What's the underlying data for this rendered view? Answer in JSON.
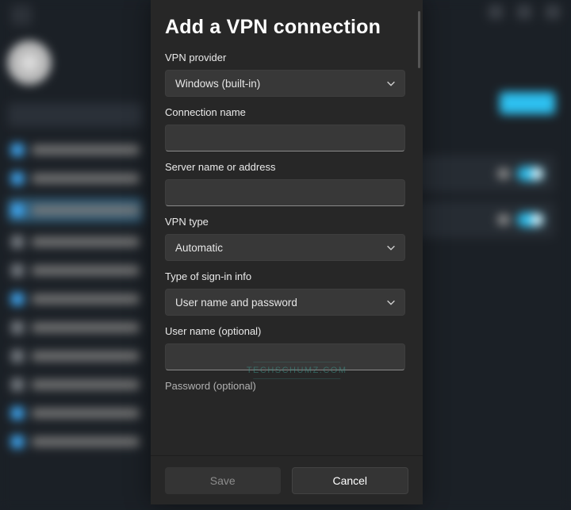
{
  "dialog": {
    "title": "Add a VPN connection",
    "labels": {
      "vpn_provider": "VPN provider",
      "connection_name": "Connection name",
      "server": "Server name or address",
      "vpn_type": "VPN type",
      "signin_type": "Type of sign-in info",
      "username": "User name (optional)",
      "password": "Password (optional)"
    },
    "values": {
      "vpn_provider": "Windows (built-in)",
      "connection_name": "",
      "server": "",
      "vpn_type": "Automatic",
      "signin_type": "User name and password",
      "username": "",
      "password": ""
    },
    "buttons": {
      "save": "Save",
      "cancel": "Cancel"
    }
  },
  "watermark": "TECHSCHUMZ.COM",
  "icons": {
    "chevron_down": "chevron-down-icon"
  },
  "colors": {
    "dialog_bg": "#272727",
    "control_bg": "#383838",
    "accent": "#2dc0f0"
  }
}
